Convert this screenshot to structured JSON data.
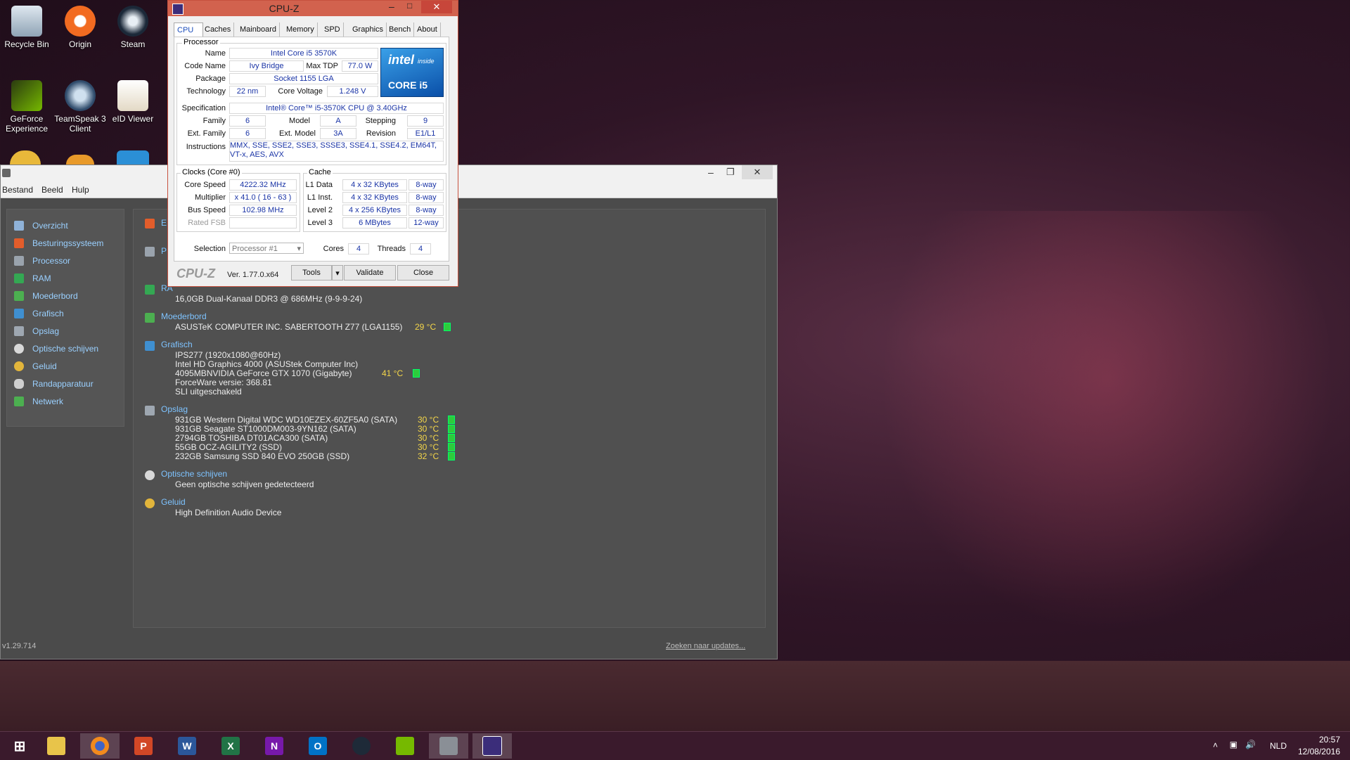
{
  "desktop": {
    "icons": [
      {
        "label": "Recycle Bin"
      },
      {
        "label": "Origin"
      },
      {
        "label": "Steam"
      },
      {
        "label": "GeForce Experience"
      },
      {
        "label": "TeamSpeak 3 Client"
      },
      {
        "label": "eID Viewer"
      }
    ]
  },
  "cpuz": {
    "title": "CPU-Z",
    "tabs": [
      "CPU",
      "Caches",
      "Mainboard",
      "Memory",
      "SPD",
      "Graphics",
      "Bench",
      "About"
    ],
    "selected_tab": "CPU",
    "processor": {
      "group": "Processor",
      "name_label": "Name",
      "name": "Intel Core i5 3570K",
      "codename_label": "Code Name",
      "codename": "Ivy Bridge",
      "maxtdp_label": "Max TDP",
      "maxtdp": "77.0 W",
      "package_label": "Package",
      "package": "Socket 1155 LGA",
      "technology_label": "Technology",
      "technology": "22 nm",
      "corevoltage_label": "Core Voltage",
      "corevoltage": "1.248 V",
      "spec_label": "Specification",
      "spec": "Intel® Core™ i5-3570K CPU @ 3.40GHz",
      "family_label": "Family",
      "family": "6",
      "model_label": "Model",
      "model": "A",
      "stepping_label": "Stepping",
      "stepping": "9",
      "extfamily_label": "Ext. Family",
      "extfamily": "6",
      "extmodel_label": "Ext. Model",
      "extmodel": "3A",
      "revision_label": "Revision",
      "revision": "E1/L1",
      "instructions_label": "Instructions",
      "instructions": "MMX, SSE, SSE2, SSE3, SSSE3, SSE4.1, SSE4.2, EM64T, VT-x, AES, AVX"
    },
    "logo": {
      "brand": "intel",
      "inside": "inside",
      "product": "CORE i5"
    },
    "clocks": {
      "group": "Clocks (Core #0)",
      "corespeed_label": "Core Speed",
      "corespeed": "4222.32 MHz",
      "multiplier_label": "Multiplier",
      "multiplier": "x 41.0 ( 16 - 63 )",
      "busspeed_label": "Bus Speed",
      "busspeed": "102.98 MHz",
      "ratedfsb_label": "Rated FSB",
      "ratedfsb": ""
    },
    "cache": {
      "group": "Cache",
      "l1data_label": "L1 Data",
      "l1data": "4 x 32 KBytes",
      "l1data_way": "8-way",
      "l1inst_label": "L1 Inst.",
      "l1inst": "4 x 32 KBytes",
      "l1inst_way": "8-way",
      "l2_label": "Level 2",
      "l2": "4 x 256 KBytes",
      "l2_way": "8-way",
      "l3_label": "Level 3",
      "l3": "6 MBytes",
      "l3_way": "12-way"
    },
    "selection": {
      "label": "Selection",
      "value": "Processor #1",
      "cores_label": "Cores",
      "cores": "4",
      "threads_label": "Threads",
      "threads": "4"
    },
    "footer": {
      "brand": "CPU-Z",
      "version": "Ver. 1.77.0.x64",
      "tools": "Tools",
      "validate": "Validate",
      "close": "Close"
    }
  },
  "speccy": {
    "menu": [
      "Bestand",
      "Beeld",
      "Hulp"
    ],
    "sidebar": [
      {
        "label": "Overzicht",
        "color": "#8fb2d8"
      },
      {
        "label": "Besturingssysteem",
        "color": "#e35d2b"
      },
      {
        "label": "Processor",
        "color": "#9aa3ad"
      },
      {
        "label": "RAM",
        "color": "#34a853"
      },
      {
        "label": "Moederbord",
        "color": "#4caf50"
      },
      {
        "label": "Grafisch",
        "color": "#3f8fd0"
      },
      {
        "label": "Opslag",
        "color": "#9ea7b1"
      },
      {
        "label": "Optische schijven",
        "color": "#d8d8d8"
      },
      {
        "label": "Geluid",
        "color": "#e2b53b"
      },
      {
        "label": "Randapparatuur",
        "color": "#cfcfcf"
      },
      {
        "label": "Netwerk",
        "color": "#4caf50"
      }
    ],
    "partial": {
      "e": "E",
      "p": "P",
      "r": "RA"
    },
    "ram_line": "16,0GB Dual-Kanaal DDR3 @ 686MHz (9-9-9-24)",
    "sections": {
      "moederbord": {
        "title": "Moederbord",
        "line": "ASUSTeK COMPUTER INC. SABERTOOTH Z77 (LGA1155)",
        "temp": "29 °C"
      },
      "grafisch": {
        "title": "Grafisch",
        "lines": [
          "IPS277 (1920x1080@60Hz)",
          "Intel HD Graphics 4000 (ASUStek Computer Inc)",
          "4095MBNVIDIA GeForce GTX 1070 (Gigabyte)",
          "ForceWare versie: 368.81",
          "SLI uitgeschakeld"
        ],
        "temp": "41 °C"
      },
      "opslag": {
        "title": "Opslag",
        "disks": [
          {
            "line": "931GB Western Digital WDC WD10EZEX-60ZF5A0 (SATA)",
            "temp": "30 °C"
          },
          {
            "line": "931GB Seagate ST1000DM003-9YN162 (SATA)",
            "temp": "30 °C"
          },
          {
            "line": "2794GB TOSHIBA DT01ACA300 (SATA)",
            "temp": "30 °C"
          },
          {
            "line": "55GB OCZ-AGILITY2 (SSD)",
            "temp": "30 °C"
          },
          {
            "line": "232GB Samsung SSD 840 EVO 250GB (SSD)",
            "temp": "32 °C"
          }
        ]
      },
      "optisch": {
        "title": "Optische schijven",
        "line": "Geen optische schijven gedetecteerd"
      },
      "geluid": {
        "title": "Geluid",
        "line": "High Definition Audio Device"
      }
    },
    "version": "v1.29.714",
    "update_link": "Zoeken naar updates..."
  },
  "taskbar": {
    "language": "NLD",
    "time": "20:57",
    "date": "12/08/2016"
  }
}
